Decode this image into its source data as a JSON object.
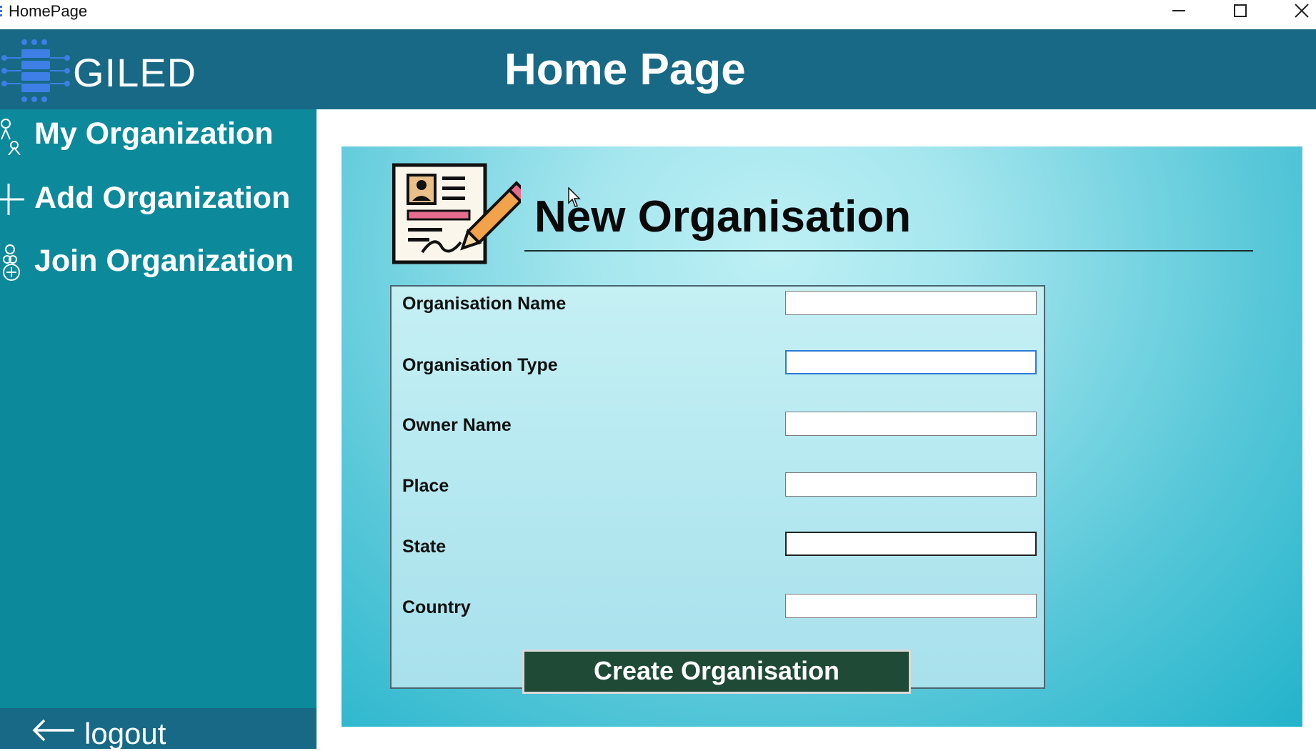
{
  "window": {
    "title": "HomePage"
  },
  "header": {
    "logo_text": "GILED",
    "page_title": "Home Page"
  },
  "sidebar": {
    "items": [
      {
        "label": "My Organization",
        "icon": "people-icon"
      },
      {
        "label": "Add Organization",
        "icon": "plus-icon"
      },
      {
        "label": "Join Organization",
        "icon": "join-icon"
      }
    ],
    "logout": {
      "label": "logout",
      "icon": "arrow-left-icon"
    }
  },
  "form": {
    "heading": "New Organisation",
    "fields": [
      {
        "label": "Organisation Name",
        "value": "",
        "state": "normal"
      },
      {
        "label": "Organisation Type",
        "value": "",
        "state": "focused"
      },
      {
        "label": "Owner Name",
        "value": "",
        "state": "normal"
      },
      {
        "label": "Place",
        "value": "",
        "state": "normal"
      },
      {
        "label": "State",
        "value": "",
        "state": "active-border"
      },
      {
        "label": "Country",
        "value": "",
        "state": "normal"
      }
    ],
    "submit_label": "Create Organisation"
  },
  "colors": {
    "header": "#176985",
    "sidebar": "#0c8a9b",
    "button": "#1f4a35",
    "panel": "#59c8d9"
  }
}
